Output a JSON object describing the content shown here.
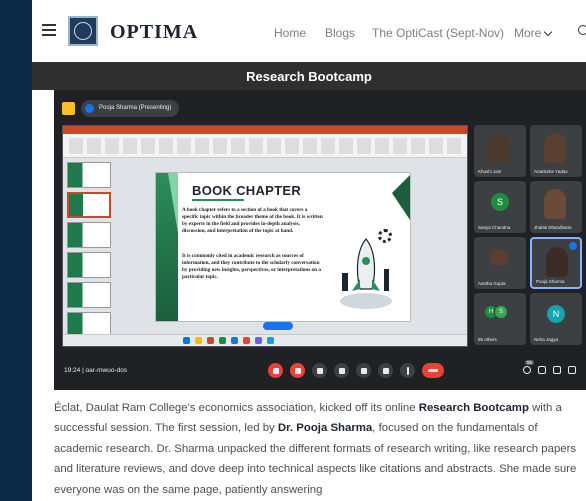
{
  "header": {
    "brand": "OPTIMA",
    "nav": [
      "Home",
      "Blogs",
      "The OptiCast (Sept-Nov)",
      "More"
    ]
  },
  "banner_title": "Research Bootcamp",
  "meeting": {
    "presenting_label": "Pooja Sharma (Presenting)",
    "slide": {
      "title": "BOOK CHAPTER",
      "paragraph1": "A book chapter refers to a section of a book that covers a specific topic within the broader theme of the book. It is written by experts in the field and provides in-depth analysis, discussion, and interpretation of the topic at hand.",
      "paragraph2": "It is commonly cited in academic research as sources of information, and they contribute to the scholarly conversation by providing new insights, perspectives, or interpretations on a particular topic."
    },
    "participants": [
      {
        "name": "Khushi Jain"
      },
      {
        "name": "Anankshe Yadav"
      },
      {
        "name": "Sanya Chandna",
        "initial": "S"
      },
      {
        "name": "Jhalak Dhandharia"
      },
      {
        "name": "Aastha Gupta"
      },
      {
        "name": "Pooja Sharma"
      },
      {
        "name": "85 others",
        "initials": [
          "H",
          "S"
        ]
      },
      {
        "name": "Neha Jagya",
        "initial": "N"
      }
    ],
    "people_count": "95",
    "clock": "19:24 | oar-mwuo-dos"
  },
  "article": {
    "p1_a": "Éclat, Daulat Ram College's economics association, kicked off its online ",
    "p1_b": "Research Bootcamp",
    "p1_c": " with a successful session. The first session, led by ",
    "p1_d": "Dr. Pooja Sharma",
    "p1_e": ", focused on the fundamentals of academic research. Dr. Sharma unpacked the different formats of research writing, like research papers and literature reviews, and dove deep into technical aspects like citations and abstracts. She made sure everyone was on the same page, patiently answering"
  },
  "colors": {
    "page_bg": "#0b2a48",
    "title_bar": "#2f2f30",
    "meet_bg": "#202124",
    "accent_red": "#ea4335",
    "slide_green": "#2c8d5b"
  }
}
